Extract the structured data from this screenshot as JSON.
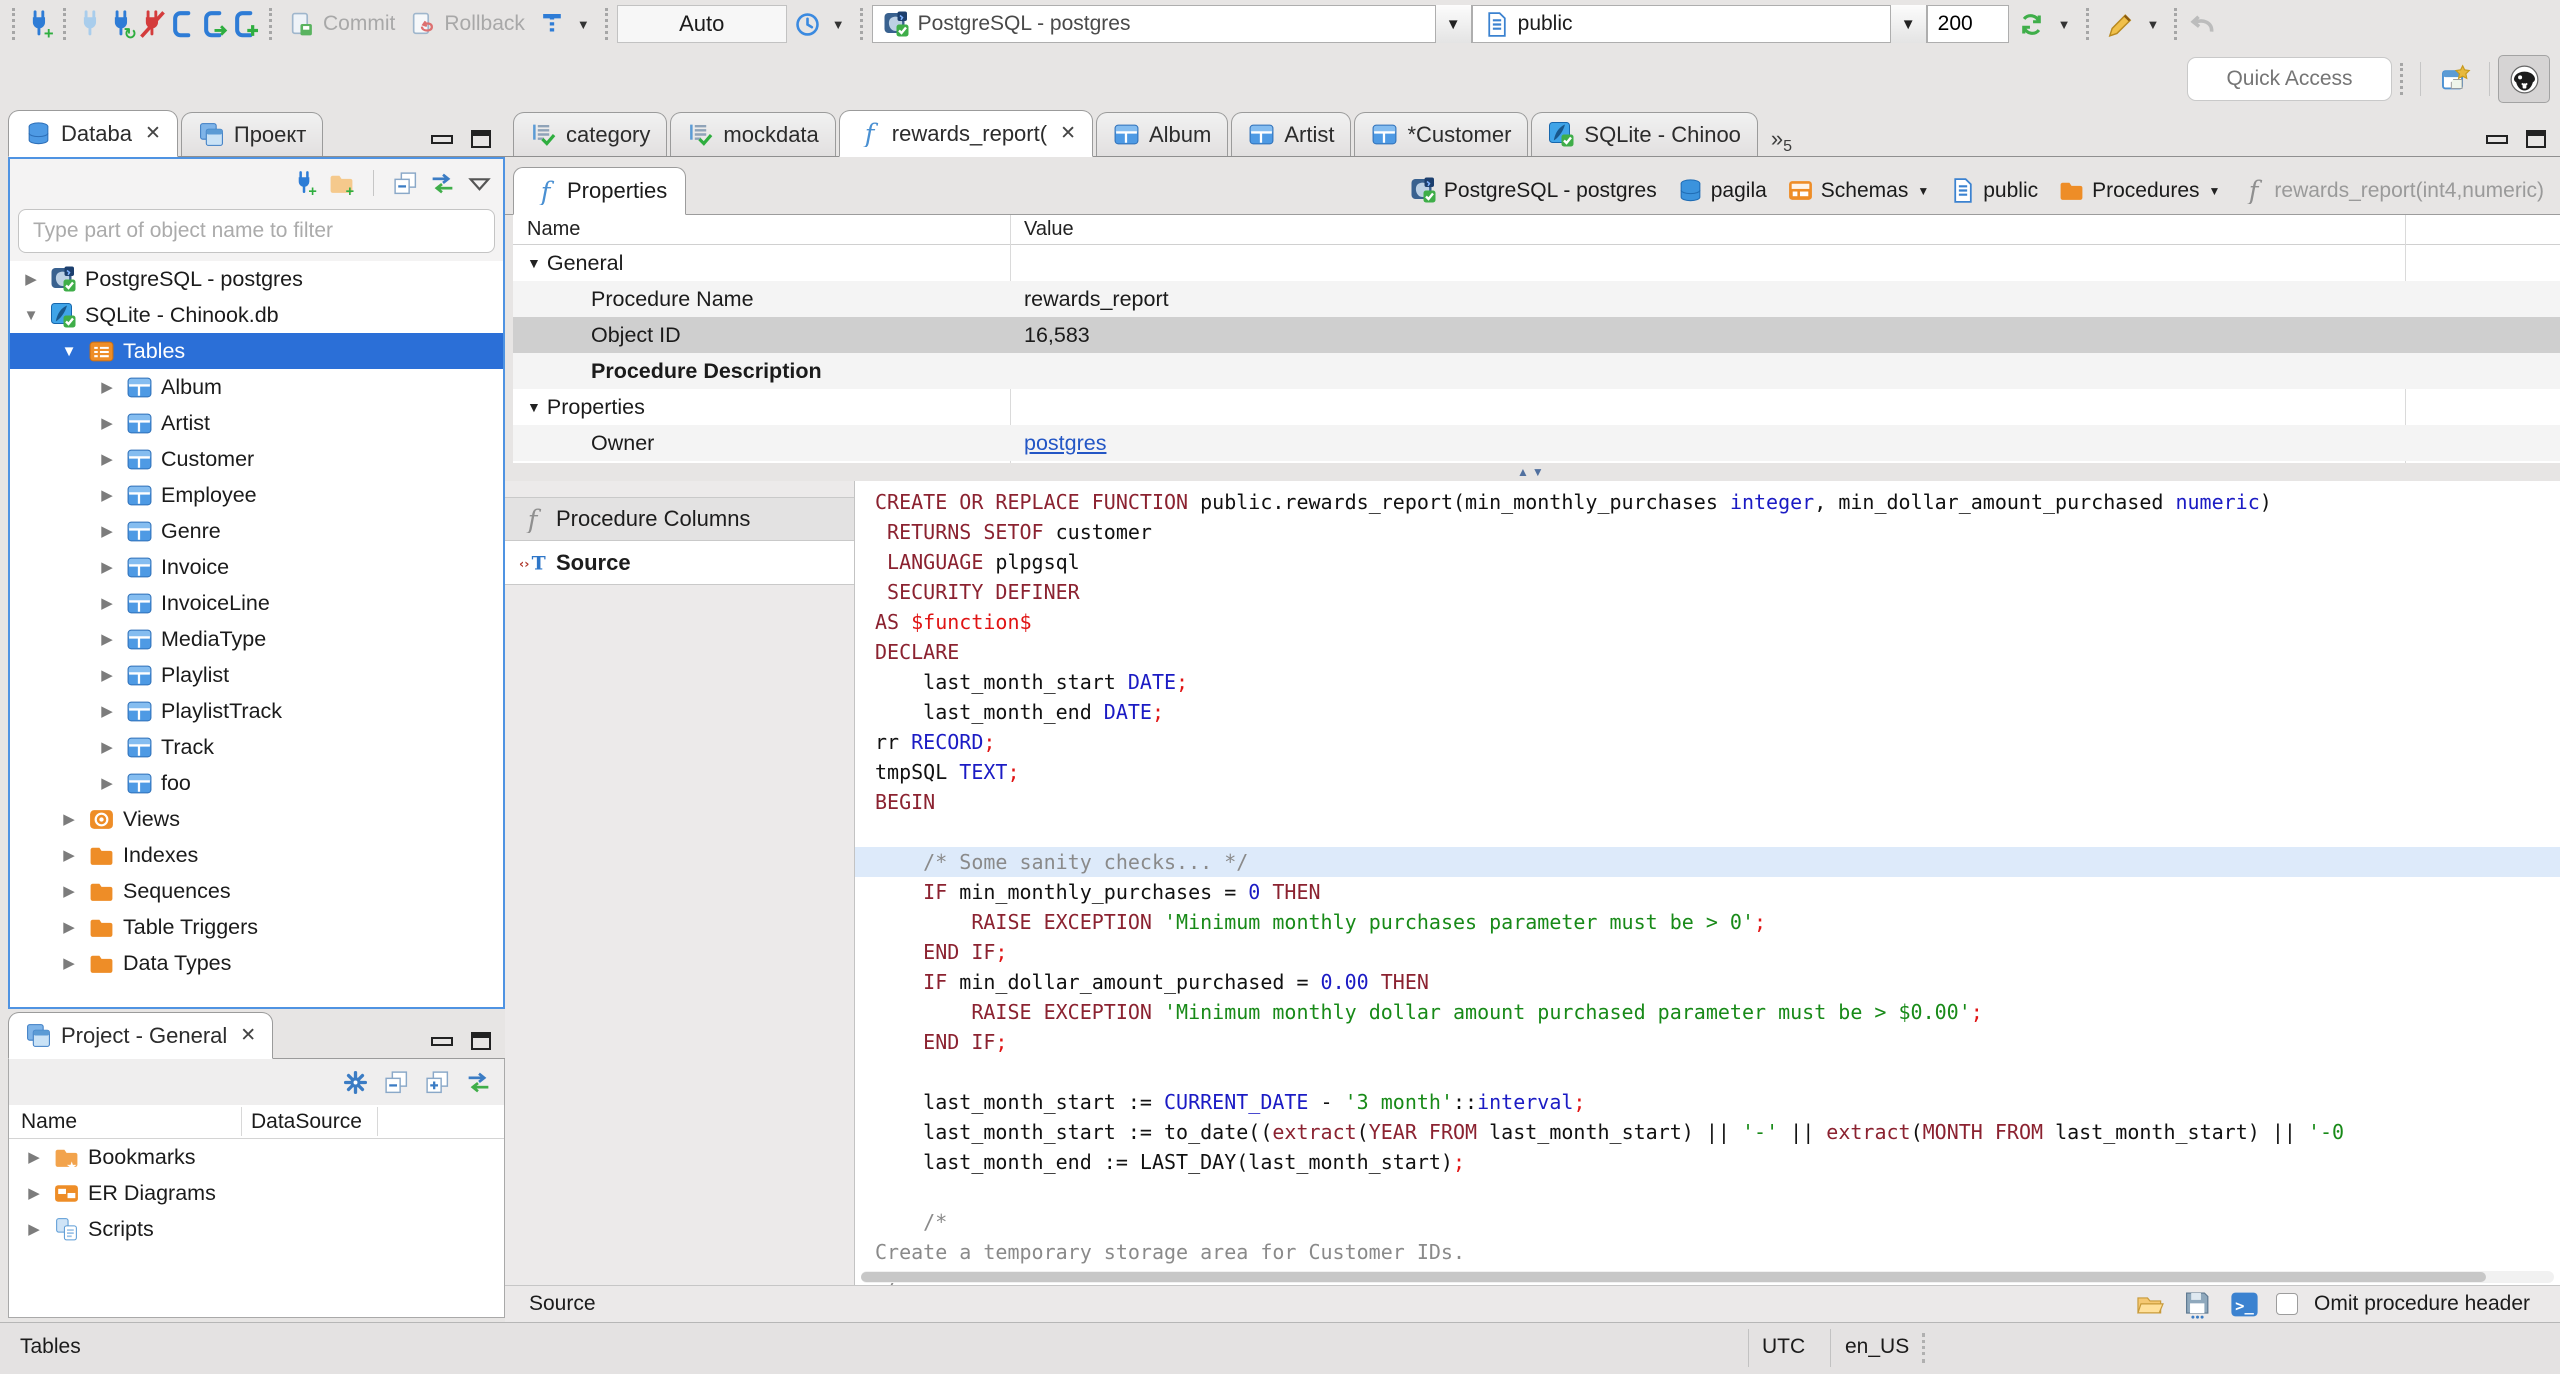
{
  "window": {
    "quick_access_placeholder": "Quick Access"
  },
  "toolbar": {
    "commit_label": "Commit",
    "rollback_label": "Rollback",
    "auto_label": "Auto",
    "connection_value": "PostgreSQL - postgres",
    "schema_value": "public",
    "fetch_size_value": "200",
    "icons": [
      "new-connection-plug",
      "connect-plug",
      "reconnect-plug",
      "disconnect-plug",
      "transaction-bracket",
      "transaction-jump",
      "transaction-add",
      "commit-doc",
      "rollback-doc",
      "transaction-filter",
      "history-clock",
      "catalog-page",
      "refresh",
      "edit-pencil",
      "undo",
      "open-perspective",
      "dbeaver-perspective"
    ]
  },
  "sidebar": {
    "tabs": [
      {
        "label": "Databa",
        "icon": "database-stack-icon",
        "active": true,
        "closable": true
      },
      {
        "label": "Проект",
        "icon": "project-icon",
        "active": false,
        "closable": false
      }
    ],
    "filter_placeholder": "Type part of object name to filter",
    "tree": [
      {
        "level": 0,
        "arrow": "collapsed",
        "icon": "postgres-icon",
        "label": "PostgreSQL - postgres"
      },
      {
        "level": 0,
        "arrow": "expanded",
        "icon": "sqlite-icon",
        "label": "SQLite - Chinook.db"
      },
      {
        "level": 1,
        "arrow": "expanded",
        "icon": "tables-icon",
        "label": "Tables",
        "selected": true
      },
      {
        "level": 2,
        "arrow": "collapsed",
        "icon": "table-icon",
        "label": "Album"
      },
      {
        "level": 2,
        "arrow": "collapsed",
        "icon": "table-icon",
        "label": "Artist"
      },
      {
        "level": 2,
        "arrow": "collapsed",
        "icon": "table-icon",
        "label": "Customer"
      },
      {
        "level": 2,
        "arrow": "collapsed",
        "icon": "table-icon",
        "label": "Employee"
      },
      {
        "level": 2,
        "arrow": "collapsed",
        "icon": "table-icon",
        "label": "Genre"
      },
      {
        "level": 2,
        "arrow": "collapsed",
        "icon": "table-icon",
        "label": "Invoice"
      },
      {
        "level": 2,
        "arrow": "collapsed",
        "icon": "table-icon",
        "label": "InvoiceLine"
      },
      {
        "level": 2,
        "arrow": "collapsed",
        "icon": "table-icon",
        "label": "MediaType"
      },
      {
        "level": 2,
        "arrow": "collapsed",
        "icon": "table-icon",
        "label": "Playlist"
      },
      {
        "level": 2,
        "arrow": "collapsed",
        "icon": "table-icon",
        "label": "PlaylistTrack"
      },
      {
        "level": 2,
        "arrow": "collapsed",
        "icon": "table-icon",
        "label": "Track"
      },
      {
        "level": 2,
        "arrow": "collapsed",
        "icon": "table-icon",
        "label": "foo"
      },
      {
        "level": 1,
        "arrow": "collapsed",
        "icon": "views-icon",
        "label": "Views"
      },
      {
        "level": 1,
        "arrow": "collapsed",
        "icon": "folder-icon",
        "label": "Indexes"
      },
      {
        "level": 1,
        "arrow": "collapsed",
        "icon": "folder-icon",
        "label": "Sequences"
      },
      {
        "level": 1,
        "arrow": "collapsed",
        "icon": "folder-icon",
        "label": "Table Triggers"
      },
      {
        "level": 1,
        "arrow": "collapsed",
        "icon": "folder-icon",
        "label": "Data Types"
      }
    ],
    "project_panel": {
      "title": "Project - General",
      "columns": [
        "Name",
        "DataSource"
      ],
      "items": [
        {
          "icon": "bookmarks-icon",
          "label": "Bookmarks"
        },
        {
          "icon": "er-icon",
          "label": "ER Diagrams"
        },
        {
          "icon": "scripts-icon",
          "label": "Scripts"
        }
      ]
    }
  },
  "editor": {
    "tabs": [
      {
        "icon": "script-icon",
        "label": "category"
      },
      {
        "icon": "script-icon",
        "label": "mockdata"
      },
      {
        "icon": "function-icon",
        "label": "rewards_report(",
        "active": true,
        "closable": true
      },
      {
        "icon": "table-icon",
        "label": "Album"
      },
      {
        "icon": "table-icon",
        "label": "Artist"
      },
      {
        "icon": "table-icon",
        "label": "*Customer"
      },
      {
        "icon": "sqlite-icon",
        "label": "SQLite - Chinoo"
      }
    ],
    "tab_overflow_count": "5",
    "properties_tab_label": "Properties",
    "breadcrumb": [
      {
        "icon": "postgres-icon",
        "label": "PostgreSQL - postgres"
      },
      {
        "icon": "db-icon",
        "label": "pagila"
      },
      {
        "icon": "schemas-icon",
        "label": "Schemas",
        "dropdown": true
      },
      {
        "icon": "page-icon",
        "label": "public"
      },
      {
        "icon": "folder-icon",
        "label": "Procedures",
        "dropdown": true
      },
      {
        "icon": "function-gray-icon",
        "label": "rewards_report(int4,numeric)",
        "muted": true
      }
    ],
    "grid": {
      "name_col": "Name",
      "value_col": "Value",
      "rows": [
        {
          "kind": "group",
          "name": "General"
        },
        {
          "kind": "item",
          "name": "Procedure Name",
          "value": "rewards_report"
        },
        {
          "kind": "item",
          "name": "Object ID",
          "value": "16,583",
          "selected": true
        },
        {
          "kind": "item",
          "name": "Procedure Description",
          "value": "",
          "bold": true
        },
        {
          "kind": "group",
          "name": "Properties"
        },
        {
          "kind": "item",
          "name": "Owner",
          "value": "postgres",
          "link": true
        }
      ]
    },
    "panel_tabs": [
      {
        "icon": "function-gray-icon",
        "label": "Procedure Columns",
        "active": false
      },
      {
        "icon": "source-icon",
        "label": "Source",
        "active": true
      }
    ],
    "footer": {
      "label": "Source",
      "omit_label": "Omit procedure header"
    }
  },
  "code": {
    "highlight_line": 12,
    "lines": [
      [
        {
          "c": "k",
          "t": "CREATE OR REPLACE FUNCTION"
        },
        {
          "c": "p",
          "t": " public.rewards_report(min_monthly_purchases "
        },
        {
          "c": "t",
          "t": "integer"
        },
        {
          "c": "p",
          "t": ", min_dollar_amount_purchased "
        },
        {
          "c": "t",
          "t": "numeric"
        },
        {
          "c": "p",
          "t": ")"
        }
      ],
      [
        {
          "c": "p",
          "t": " "
        },
        {
          "c": "k",
          "t": "RETURNS SETOF"
        },
        {
          "c": "p",
          "t": " customer"
        }
      ],
      [
        {
          "c": "p",
          "t": " "
        },
        {
          "c": "k",
          "t": "LANGUAGE"
        },
        {
          "c": "p",
          "t": " plpgsql"
        }
      ],
      [
        {
          "c": "p",
          "t": " "
        },
        {
          "c": "k",
          "t": "SECURITY DEFINER"
        }
      ],
      [
        {
          "c": "k",
          "t": "AS"
        },
        {
          "c": "p",
          "t": " "
        },
        {
          "c": "r",
          "t": "$function$"
        }
      ],
      [
        {
          "c": "k",
          "t": "DECLARE"
        }
      ],
      [
        {
          "c": "p",
          "t": "    last_month_start "
        },
        {
          "c": "t",
          "t": "DATE"
        },
        {
          "c": "r",
          "t": ";"
        }
      ],
      [
        {
          "c": "p",
          "t": "    last_month_end "
        },
        {
          "c": "t",
          "t": "DATE"
        },
        {
          "c": "r",
          "t": ";"
        }
      ],
      [
        {
          "c": "p",
          "t": "rr "
        },
        {
          "c": "t",
          "t": "RECORD"
        },
        {
          "c": "r",
          "t": ";"
        }
      ],
      [
        {
          "c": "p",
          "t": "tmpSQL "
        },
        {
          "c": "t",
          "t": "TEXT"
        },
        {
          "c": "r",
          "t": ";"
        }
      ],
      [
        {
          "c": "k",
          "t": "BEGIN"
        }
      ],
      [],
      [
        {
          "c": "c",
          "t": "    /* Some sanity checks... */"
        }
      ],
      [
        {
          "c": "p",
          "t": "    "
        },
        {
          "c": "k",
          "t": "IF"
        },
        {
          "c": "p",
          "t": " min_monthly_purchases = "
        },
        {
          "c": "t",
          "t": "0"
        },
        {
          "c": "p",
          "t": " "
        },
        {
          "c": "k",
          "t": "THEN"
        }
      ],
      [
        {
          "c": "p",
          "t": "        "
        },
        {
          "c": "k",
          "t": "RAISE EXCEPTION"
        },
        {
          "c": "p",
          "t": " "
        },
        {
          "c": "s",
          "t": "'Minimum monthly purchases parameter must be > 0'"
        },
        {
          "c": "r",
          "t": ";"
        }
      ],
      [
        {
          "c": "p",
          "t": "    "
        },
        {
          "c": "k",
          "t": "END IF"
        },
        {
          "c": "r",
          "t": ";"
        }
      ],
      [
        {
          "c": "p",
          "t": "    "
        },
        {
          "c": "k",
          "t": "IF"
        },
        {
          "c": "p",
          "t": " min_dollar_amount_purchased = "
        },
        {
          "c": "t",
          "t": "0.00"
        },
        {
          "c": "p",
          "t": " "
        },
        {
          "c": "k",
          "t": "THEN"
        }
      ],
      [
        {
          "c": "p",
          "t": "        "
        },
        {
          "c": "k",
          "t": "RAISE EXCEPTION"
        },
        {
          "c": "p",
          "t": " "
        },
        {
          "c": "s",
          "t": "'Minimum monthly dollar amount purchased parameter must be > $0.00'"
        },
        {
          "c": "r",
          "t": ";"
        }
      ],
      [
        {
          "c": "p",
          "t": "    "
        },
        {
          "c": "k",
          "t": "END IF"
        },
        {
          "c": "r",
          "t": ";"
        }
      ],
      [],
      [
        {
          "c": "p",
          "t": "    last_month_start := "
        },
        {
          "c": "t",
          "t": "CURRENT_DATE"
        },
        {
          "c": "p",
          "t": " - "
        },
        {
          "c": "s",
          "t": "'3 month'"
        },
        {
          "c": "p",
          "t": "::"
        },
        {
          "c": "t",
          "t": "interval"
        },
        {
          "c": "r",
          "t": ";"
        }
      ],
      [
        {
          "c": "p",
          "t": "    last_month_start := to_date(("
        },
        {
          "c": "k",
          "t": "extract"
        },
        {
          "c": "p",
          "t": "("
        },
        {
          "c": "k",
          "t": "YEAR FROM"
        },
        {
          "c": "p",
          "t": " last_month_start) || "
        },
        {
          "c": "s",
          "t": "'-'"
        },
        {
          "c": "p",
          "t": " || "
        },
        {
          "c": "k",
          "t": "extract"
        },
        {
          "c": "p",
          "t": "("
        },
        {
          "c": "k",
          "t": "MONTH FROM"
        },
        {
          "c": "p",
          "t": " last_month_start) || "
        },
        {
          "c": "s",
          "t": "'-0"
        }
      ],
      [
        {
          "c": "p",
          "t": "    last_month_end := LAST_DAY(last_month_start)"
        },
        {
          "c": "r",
          "t": ";"
        }
      ],
      [],
      [
        {
          "c": "c",
          "t": "    /*"
        }
      ],
      [
        {
          "c": "c",
          "t": "Create a temporary storage area for Customer IDs."
        }
      ],
      [
        {
          "c": "c",
          "t": "*/"
        }
      ]
    ]
  },
  "statusbar": {
    "left": "Tables",
    "timezone": "UTC",
    "locale": "en_US"
  },
  "colors": {
    "selection": "#2b6fd7",
    "focus_border": "#4f93e2",
    "keyword": "#8b2230",
    "type": "#1b1bc4",
    "string": "#188a18",
    "comment": "#8a8a8a",
    "red": "#e01414",
    "current_line": "#ddeafa"
  }
}
